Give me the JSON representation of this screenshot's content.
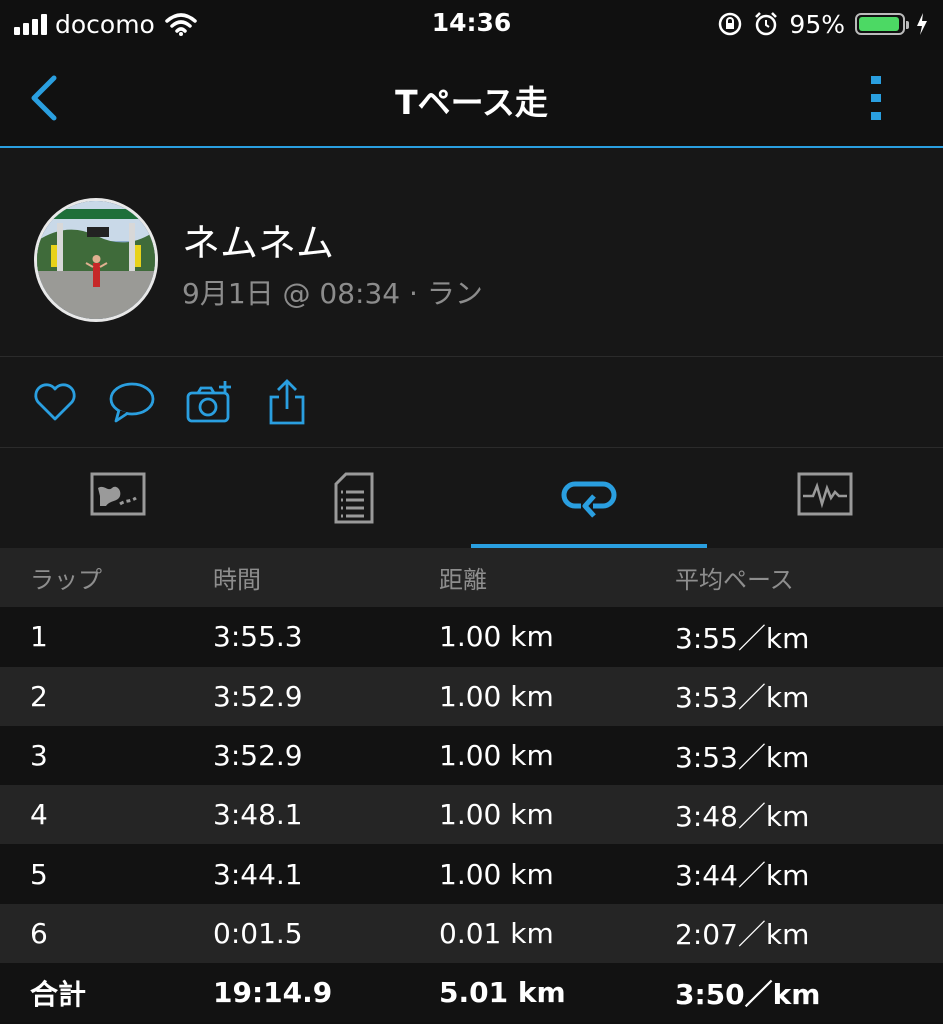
{
  "status_bar": {
    "carrier": "docomo",
    "time": "14:36",
    "battery_percent": "95%",
    "battery_level": 0.95,
    "battery_color": "#4cd964"
  },
  "nav": {
    "title": "Tペース走",
    "back_icon": "chevron-left-icon",
    "more_icon": "vertical-dots-icon"
  },
  "profile": {
    "name": "ネムネム",
    "meta": "9月1日 @ 08:34 · ラン"
  },
  "actions": [
    "heart-icon",
    "comment-icon",
    "camera-add-icon",
    "share-icon"
  ],
  "tabs": [
    {
      "icon": "map-icon",
      "active": false
    },
    {
      "icon": "document-icon",
      "active": false
    },
    {
      "icon": "laps-icon",
      "active": true
    },
    {
      "icon": "chart-icon",
      "active": false
    }
  ],
  "accent_color": "#2a9fe0",
  "laps_table": {
    "headers": [
      "ラップ",
      "時間",
      "距離",
      "平均ペース"
    ],
    "rows": [
      [
        "1",
        "3:55.3",
        "1.00 km",
        "3:55／km"
      ],
      [
        "2",
        "3:52.9",
        "1.00 km",
        "3:53／km"
      ],
      [
        "3",
        "3:52.9",
        "1.00 km",
        "3:53／km"
      ],
      [
        "4",
        "3:48.1",
        "1.00 km",
        "3:48／km"
      ],
      [
        "5",
        "3:44.1",
        "1.00 km",
        "3:44／km"
      ],
      [
        "6",
        "0:01.5",
        "0.01 km",
        "2:07／km"
      ]
    ],
    "total": [
      "合計",
      "19:14.9",
      "5.01 km",
      "3:50／km"
    ]
  }
}
